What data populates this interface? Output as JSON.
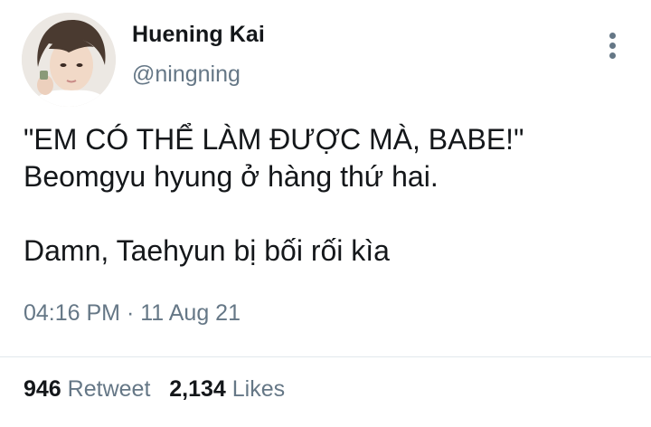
{
  "tweet": {
    "author": {
      "display_name": "Huening Kai",
      "handle": "@ningning"
    },
    "text_lines": [
      "\"EM CÓ THỂ LÀM ĐƯỢC MÀ, BABE!\"",
      "Beomgyu hyung ở hàng thứ hai.",
      "Damn, Taehyun bị bối rối kìa"
    ],
    "timestamp": "04:16 PM · 11 Aug 21",
    "stats": {
      "retweets_count": "946",
      "retweets_label": "Retweet",
      "likes_count": "2,134",
      "likes_label": "Likes"
    },
    "icons": {
      "more": "more-vertical-icon"
    },
    "colors": {
      "text": "#14171a",
      "secondary": "#657786",
      "divider": "#e1e8ed"
    }
  }
}
